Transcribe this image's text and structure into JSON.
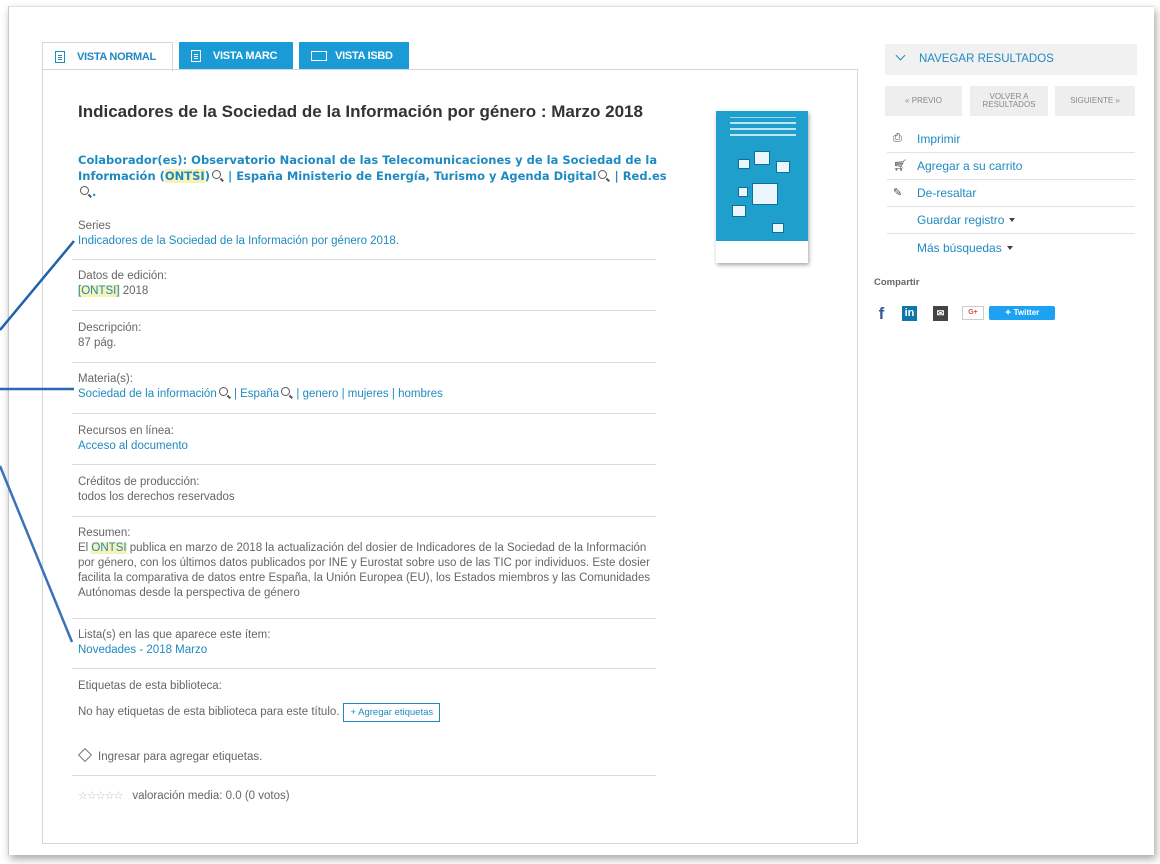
{
  "tabs": [
    {
      "label": "VISTA NORMAL"
    },
    {
      "label": "VISTA MARC"
    },
    {
      "label": "VISTA ISBD"
    }
  ],
  "record": {
    "title": "Indicadores de la Sociedad de la Información por género : Marzo 2018",
    "contributors_prefix": "Colaborador(es): ",
    "contributor1_a": "Observatorio Nacional de las Telecomunicaciones y de la Sociedad de la Información (",
    "contributor1_hl": "ONTSI",
    "contributor1_b": ")",
    "separator": "|",
    "contributor2": "España Ministerio de Energía, Turismo y Agenda Digital",
    "contributor3": "Red.es",
    "end": "."
  },
  "series": {
    "label": "Series",
    "value": "Indicadores de la Sociedad de la Información por género 2018."
  },
  "edition": {
    "label": "Datos de edición:",
    "value_hl": "[ONTSI]",
    "value_rest": " 2018"
  },
  "description": {
    "label": "Descripción:",
    "value": "87 pág."
  },
  "subjects": {
    "label": "Materia(s):",
    "items": [
      "Sociedad de la información",
      "España",
      "genero",
      "mujeres",
      "hombres"
    ],
    "separator": "|"
  },
  "online": {
    "label": "Recursos en línea:",
    "value": "Acceso al documento"
  },
  "credits": {
    "label": "Créditos de producción:",
    "value": "todos los derechos reservados"
  },
  "summary": {
    "label": "Resumen:",
    "pre": "El ",
    "hl": "ONTSI",
    "post": " publica en marzo de 2018 la actualización del dosier de Indicadores de la Sociedad de la Información por género, con los últimos datos publicados por INE y Eurostat sobre uso de las TIC por individuos. Este dosier facilita la comparativa de datos entre España, la Unión Europea (EU), los Estados miembros y las Comunidades Autónomas desde la perspectiva de género"
  },
  "lists": {
    "label": "Lista(s) en las que aparece este ítem:",
    "value": "Novedades - 2018 Marzo"
  },
  "tags": {
    "label": "Etiquetas de esta biblioteca:",
    "none": "No hay etiquetas de esta biblioteca para este título.",
    "add_button": "+ Agregar etiquetas",
    "login": "Ingresar para agregar etiquetas."
  },
  "rating": {
    "stars": "☆☆☆☆☆",
    "text": "valoración media: 0.0 (0 votos)"
  },
  "sidebar": {
    "nav_title": "NAVEGAR RESULTADOS",
    "prev": "« PREVIO",
    "back": "VOLVER A RESULTADOS",
    "next": "SIGUIENTE »",
    "actions": [
      {
        "label": "Imprimir",
        "icon": "printer-icon"
      },
      {
        "label": "Agregar a su carrito",
        "icon": "cart-icon"
      },
      {
        "label": "De-resaltar",
        "icon": "pencil-icon"
      },
      {
        "label": "Guardar registro"
      },
      {
        "label": "Más búsquedas"
      }
    ],
    "share_label": "Compartir",
    "social": {
      "facebook": "f",
      "linkedin": "in",
      "google": "G+",
      "twitter": "Twitter"
    }
  },
  "colors": {
    "accent": "#1f8ac0",
    "tab_blue": "#1a9bd6",
    "highlight": "#f7f2b6"
  }
}
